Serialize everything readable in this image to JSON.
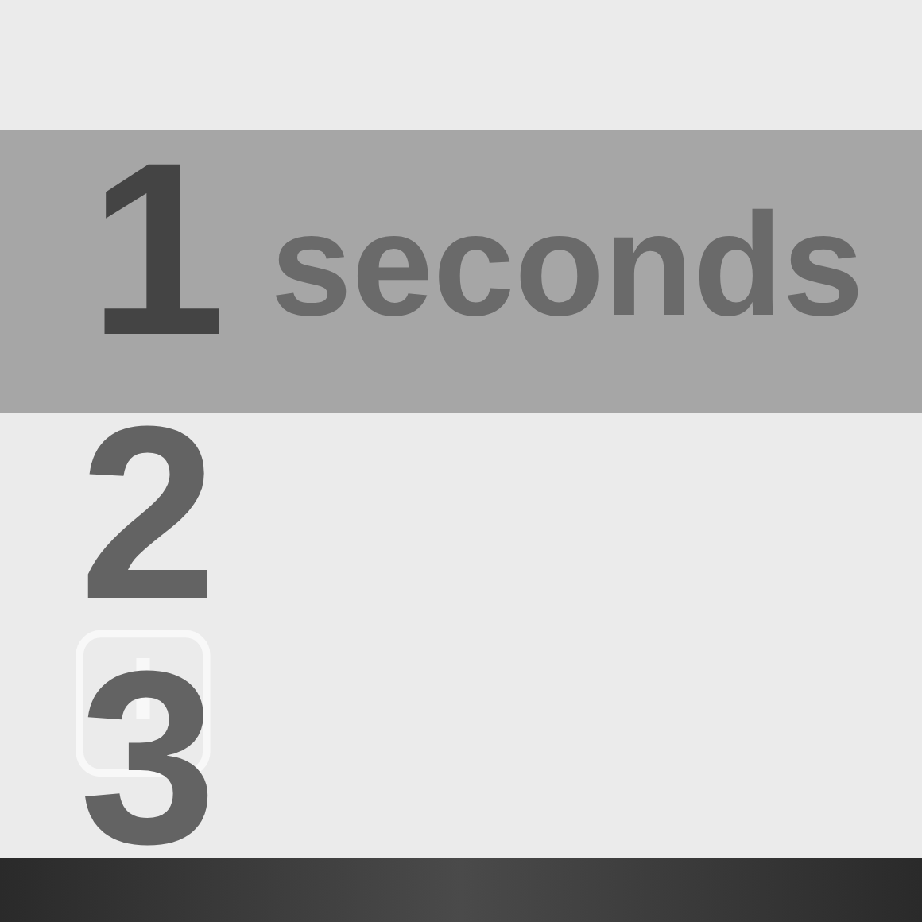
{
  "picker": {
    "rows": [
      {
        "value": "1",
        "unit": "seconds",
        "selected": true
      },
      {
        "value": "2",
        "selected": false
      },
      {
        "value": "3",
        "selected": false
      }
    ]
  }
}
